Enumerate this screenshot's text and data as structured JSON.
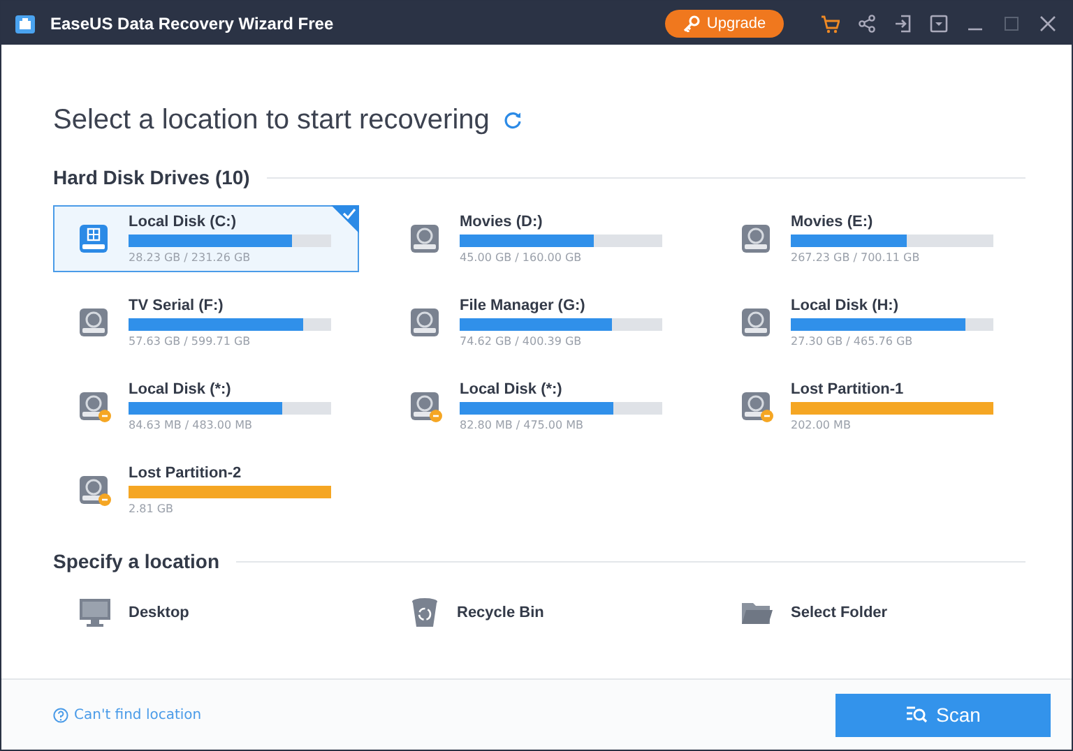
{
  "window": {
    "title": "EaseUS Data Recovery Wizard Free",
    "upgrade": "Upgrade"
  },
  "heading": "Select a location to start recovering",
  "drives_section": {
    "title": "Hard Disk Drives (10)",
    "drives": [
      {
        "kind": "system",
        "name": "Local Disk (C:)",
        "size": "28.23 GB / 231.26 GB",
        "level": 0.81,
        "selected": true
      },
      {
        "kind": "disk",
        "name": "Movies (D:)",
        "size": "45.00 GB / 160.00 GB",
        "level": 0.66,
        "selected": false
      },
      {
        "kind": "disk",
        "name": "Movies (E:)",
        "size": "267.23 GB / 700.11 GB",
        "level": 0.57,
        "selected": false
      },
      {
        "kind": "disk",
        "name": "TV Serial (F:)",
        "size": "57.63 GB / 599.71 GB",
        "level": 0.86,
        "selected": false
      },
      {
        "kind": "disk",
        "name": "File Manager (G:)",
        "size": "74.62 GB / 400.39 GB",
        "level": 0.75,
        "selected": false
      },
      {
        "kind": "disk",
        "name": "Local Disk (H:)",
        "size": "27.30 GB / 465.76 GB",
        "level": 0.86,
        "selected": false
      },
      {
        "kind": "unmounted",
        "name": "Local Disk (*:)",
        "size": "84.63 MB / 483.00 MB",
        "level": 0.76,
        "selected": false
      },
      {
        "kind": "unmounted",
        "name": "Local Disk (*:)",
        "size": "82.80 MB / 475.00 MB",
        "level": 0.76,
        "selected": false
      },
      {
        "kind": "lost",
        "name": "Lost Partition-1",
        "size": "202.00 MB",
        "level": 1,
        "selected": false
      },
      {
        "kind": "lost",
        "name": "Lost Partition-2",
        "size": "2.81 GB",
        "level": 1,
        "selected": false
      }
    ]
  },
  "locations_section": {
    "title": "Specify a location",
    "locations": [
      {
        "kind": "desktop",
        "label": "Desktop"
      },
      {
        "kind": "recycle",
        "label": "Recycle Bin"
      },
      {
        "kind": "folder",
        "label": "Select Folder"
      }
    ]
  },
  "footer": {
    "help_link": "Can't find location",
    "scan_button": "Scan"
  }
}
